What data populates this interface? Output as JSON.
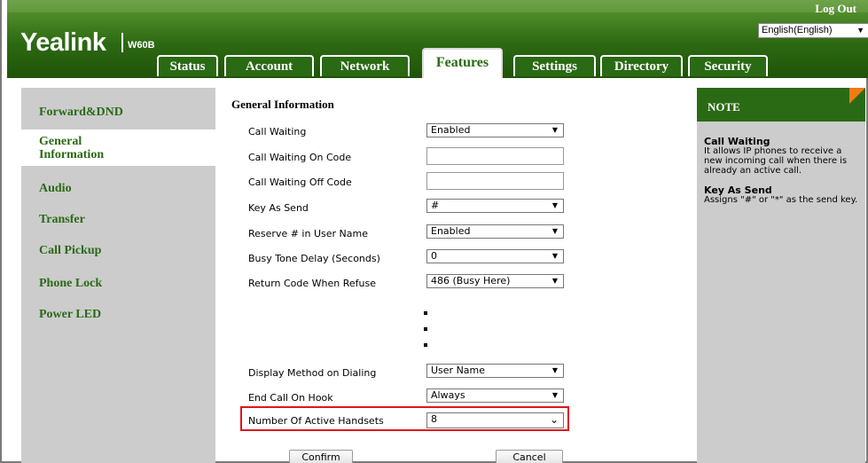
{
  "header": {
    "brand": "Yealink",
    "model": "W60B",
    "logout": "Log Out",
    "language": "English(English)"
  },
  "tabs": [
    {
      "label": "Status"
    },
    {
      "label": "Account"
    },
    {
      "label": "Network"
    },
    {
      "label": "Features",
      "active": true
    },
    {
      "label": "Settings"
    },
    {
      "label": "Directory"
    },
    {
      "label": "Security"
    }
  ],
  "sidebar": {
    "items": [
      {
        "label": "Forward&DND"
      },
      {
        "label": "General\nInformation",
        "active": true
      },
      {
        "label": "Audio"
      },
      {
        "label": "Transfer"
      },
      {
        "label": "Call Pickup"
      },
      {
        "label": "Phone Lock"
      },
      {
        "label": "Power LED"
      }
    ]
  },
  "main": {
    "section_title": "General Information",
    "rows": [
      {
        "label": "Call Waiting",
        "type": "select",
        "value": "Enabled"
      },
      {
        "label": "Call Waiting On Code",
        "type": "input",
        "value": ""
      },
      {
        "label": "Call Waiting Off Code",
        "type": "input",
        "value": ""
      },
      {
        "label": "Key As Send",
        "type": "select",
        "value": "#"
      },
      {
        "label": "Reserve # in User Name",
        "type": "select",
        "value": "Enabled"
      },
      {
        "label": "Busy Tone Delay (Seconds)",
        "type": "select",
        "value": "0"
      },
      {
        "label": "Return Code When Refuse",
        "type": "select",
        "value": "486 (Busy Here)"
      },
      {
        "label": "Display Method on Dialing",
        "type": "select",
        "value": "User Name"
      },
      {
        "label": "End Call On Hook",
        "type": "select",
        "value": "Always"
      },
      {
        "label": "Number Of Active Handsets",
        "type": "select",
        "value": "8"
      }
    ],
    "confirm_label": "Confirm",
    "cancel_label": "Cancel"
  },
  "note": {
    "heading": "NOTE",
    "entries": [
      {
        "title": "Call Waiting",
        "text": "It allows IP phones to receive a new incoming call when there is already an active call."
      },
      {
        "title": "Key As Send",
        "text": "Assigns \"#\" or \"*\" as the send key."
      }
    ]
  },
  "colors": {
    "brand_green": "#2a6a14",
    "sidebar_gray": "#cccccc",
    "highlight_red": "#e0161a",
    "note_accent": "#f07b12"
  }
}
